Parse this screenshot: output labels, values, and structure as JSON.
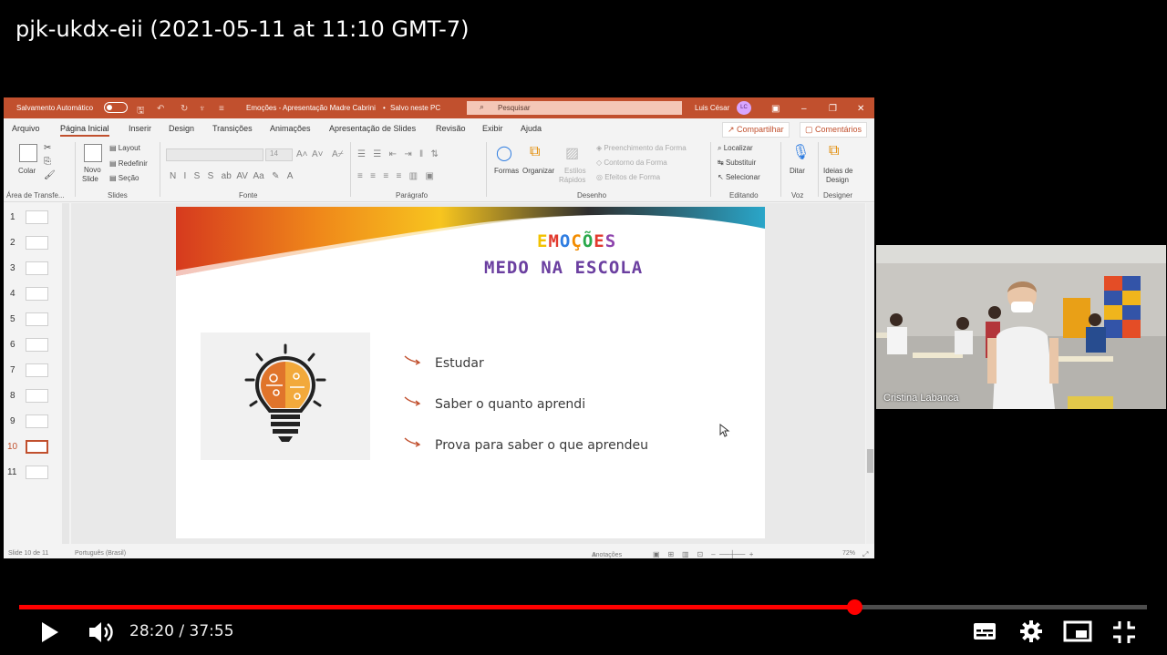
{
  "video": {
    "title": "pjk-ukdx-eii (2021-05-11 at 11:10 GMT-7)",
    "time_current": "28:20",
    "time_separator": "/",
    "time_total": "37:55",
    "progress_fraction": 0.7406,
    "progress_color": "#ff0000"
  },
  "ppt": {
    "accent": "#c1502e",
    "titlebar": {
      "autosave": "Salvamento Automático",
      "doc": "Emoções - Apresentação Madre Cabrini",
      "dot": "•",
      "saved": "Salvo neste PC",
      "search_placeholder": "Pesquisar",
      "user": "Luis César",
      "initials": "LC"
    },
    "tabs": [
      "Arquivo",
      "Página Inicial",
      "Inserir",
      "Design",
      "Transições",
      "Animações",
      "Apresentação de Slides",
      "Revisão",
      "Exibir",
      "Ajuda"
    ],
    "share": "Compartilhar",
    "comments": "Comentários",
    "ribbon": {
      "colar": "Colar",
      "novo_slide_1": "Novo",
      "novo_slide_2": "Slide",
      "layout": "Layout",
      "redefinir": "Redefinir",
      "secao": "Seção",
      "font_size": "14",
      "formas": "Formas",
      "organizar": "Organizar",
      "estilos1": "Estilos",
      "estilos2": "Rápidos",
      "preenchimento": "Preenchimento da Forma",
      "contorno": "Contorno da Forma",
      "efeitos": "Efeitos de Forma",
      "localizar": "Localizar",
      "substituir": "Substituir",
      "selecionar": "Selecionar",
      "ditar": "Ditar",
      "ideias1": "Ideias de",
      "ideias2": "Design",
      "groups": {
        "area": "Área de Transfe...",
        "slides": "Slides",
        "fonte": "Fonte",
        "paragrafo": "Parágrafo",
        "desenho": "Desenho",
        "editando": "Editando",
        "voz": "Voz",
        "designer": "Designer"
      }
    },
    "thumbnails": [
      "1",
      "2",
      "3",
      "4",
      "5",
      "6",
      "7",
      "8",
      "9",
      "10",
      "11"
    ],
    "active_slide": "10",
    "slide": {
      "title1_letters": [
        "E",
        "M",
        "O",
        "Ç",
        "Õ",
        "E",
        "S"
      ],
      "title1_colors": [
        "#f2c200",
        "#e23a2e",
        "#2f7de1",
        "#f28c00",
        "#2aa84a",
        "#e23a2e",
        "#8e44ad"
      ],
      "title2": "MEDO NA ESCOLA",
      "bullets": [
        "Estudar",
        "Saber o quanto aprendi",
        "Prova para saber o que aprendeu"
      ]
    },
    "status": {
      "slide_of": "Slide 10 de 11",
      "language": "Português (Brasil)",
      "notes": "Anotações",
      "zoom": "72%"
    }
  },
  "camera": {
    "participant": "Cristina Labanca"
  }
}
